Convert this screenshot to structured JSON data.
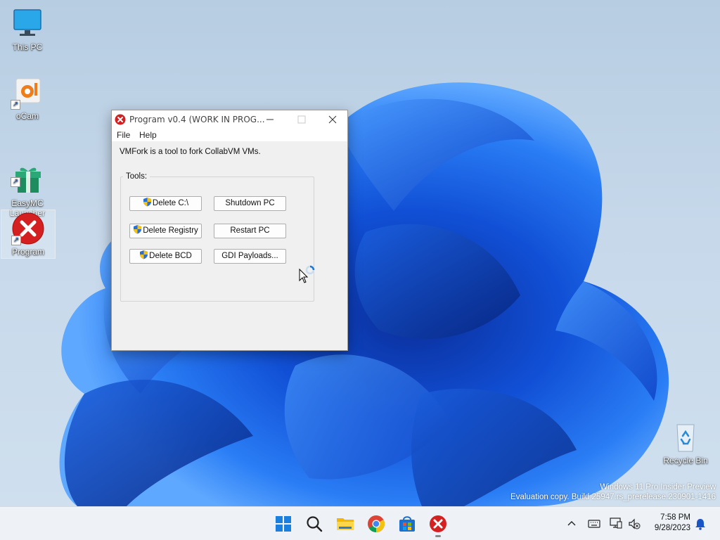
{
  "desktop": {
    "icons": [
      {
        "label": "This PC",
        "icon": "monitor-icon"
      },
      {
        "label": "oCam",
        "icon": "ocam-icon"
      },
      {
        "label": "EasyMC\nLauncher",
        "icon": "gift-icon"
      },
      {
        "label": "Program",
        "icon": "error-x-icon"
      },
      {
        "label": "Recycle Bin",
        "icon": "recycle-bin-icon"
      }
    ],
    "watermark": {
      "line1": "Windows 11 Pro Insider Preview",
      "line2": "Evaluation copy. Build 25947.rs_prerelease.230901-1416"
    }
  },
  "window": {
    "title": "Program v0.4 (WORK IN PROG...",
    "menu": [
      "File",
      "Help"
    ],
    "description": "VMFork is a tool to fork CollabVM VMs.",
    "group_label": "Tools:",
    "buttons": {
      "delete_c": "Delete C:\\",
      "shutdown": "Shutdown PC",
      "delete_registry": "Delete Registry",
      "restart": "Restart PC",
      "delete_bcd": "Delete BCD",
      "gdi_payloads": "GDI Payloads..."
    }
  },
  "taskbar": {
    "apps": [
      "start-icon",
      "search-icon",
      "file-explorer-icon",
      "chrome-icon",
      "store-icon",
      "program-icon"
    ],
    "clock": {
      "time": "7:58 PM",
      "date": "9/28/2023"
    }
  },
  "colors": {
    "accent": "#1560e8",
    "error_red": "#d42020",
    "taskbar_bg": "#eef2f7"
  }
}
